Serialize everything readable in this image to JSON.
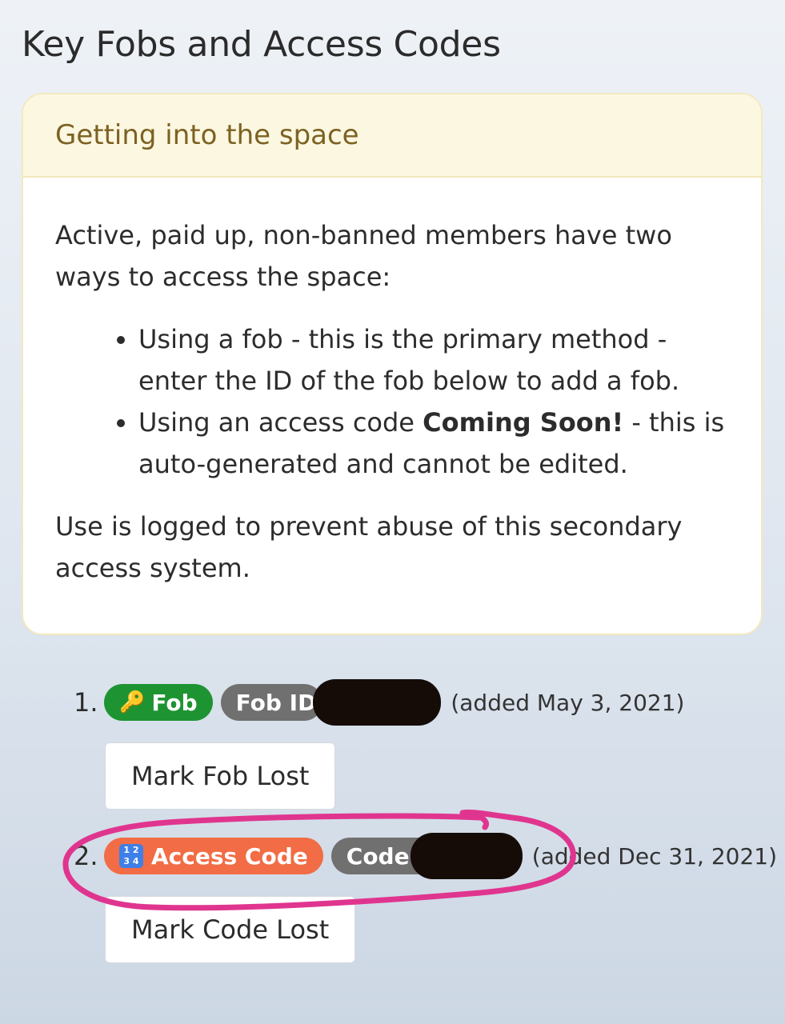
{
  "page_title": "Key Fobs and Access Codes",
  "card": {
    "title": "Getting into the space",
    "intro": "Active, paid up, non-banned members have two ways to access the space:",
    "bullet1": "Using a fob - this is the primary method - enter the ID of the fob below to add a fob.",
    "bullet2_pre": "Using an access code ",
    "bullet2_bold": "Coming Soon!",
    "bullet2_post": " - this is auto-generated and cannot be edited.",
    "footer": "Use is logged to prevent abuse of this secondary access system."
  },
  "keys": [
    {
      "number": "1.",
      "type_label": "Fob",
      "type_icon": "key-icon",
      "id_label": "Fob ID",
      "added": "(added May 3, 2021)",
      "button_label": "Mark Fob Lost",
      "badge_color": "#1e9332"
    },
    {
      "number": "2.",
      "type_label": "Access Code",
      "type_icon": "input-numbers-icon",
      "id_label": "Code:",
      "added": "(added Dec 31, 2021)",
      "button_label": "Mark Code Lost",
      "badge_color": "#f26c45"
    }
  ],
  "colors": {
    "id_badge": "#707070",
    "redaction": "#150c08",
    "highlight_circle": "#e0358f"
  }
}
